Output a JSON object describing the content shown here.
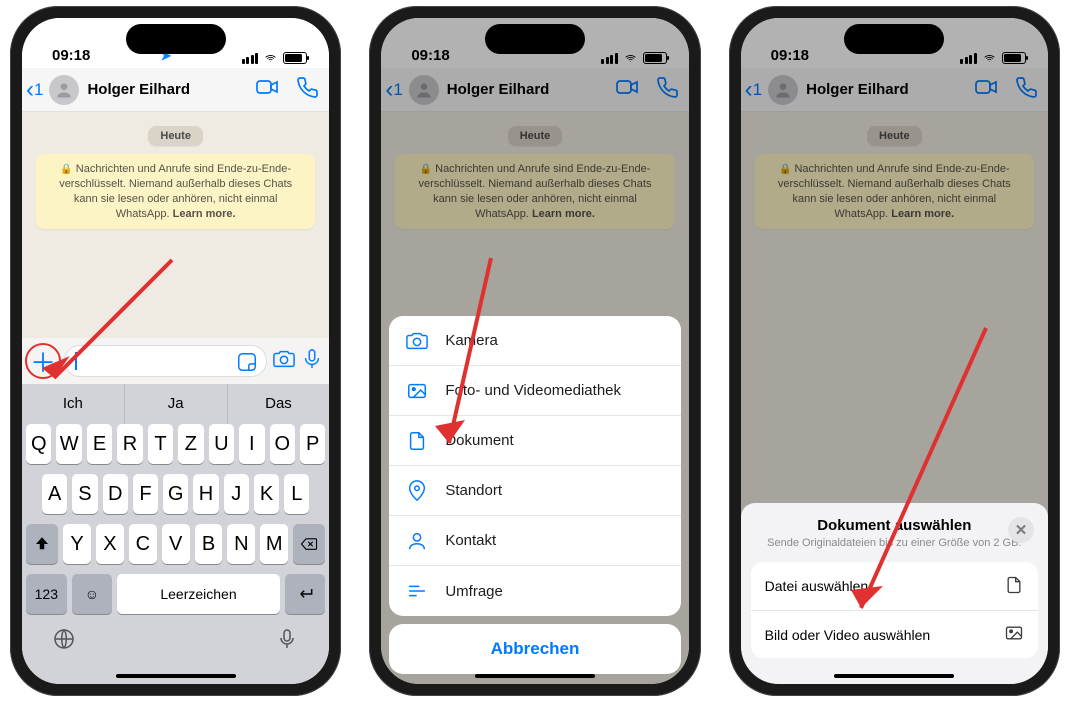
{
  "status": {
    "time": "09:18"
  },
  "chat": {
    "back_count": "1",
    "contact_name": "Holger Eilhard",
    "date_label": "Heute",
    "e2e_prefix": "Nachrichten und Anrufe sind Ende-zu-Ende-verschlüsselt. Niemand außerhalb dieses Chats kann sie lesen oder anhören, nicht einmal WhatsApp.",
    "e2e_learn": "Learn more."
  },
  "keyboard": {
    "suggestions": [
      "Ich",
      "Ja",
      "Das"
    ],
    "row1": [
      "Q",
      "W",
      "E",
      "R",
      "T",
      "Z",
      "U",
      "I",
      "O",
      "P"
    ],
    "row2": [
      "A",
      "S",
      "D",
      "F",
      "G",
      "H",
      "J",
      "K",
      "L"
    ],
    "row3": [
      "Y",
      "X",
      "C",
      "V",
      "B",
      "N",
      "M"
    ],
    "numkey": "123",
    "space": "Leerzeichen"
  },
  "attach_menu": {
    "items": [
      {
        "id": "camera",
        "label": "Kamera"
      },
      {
        "id": "photos",
        "label": "Foto- und Videomediathek"
      },
      {
        "id": "document",
        "label": "Dokument"
      },
      {
        "id": "location",
        "label": "Standort"
      },
      {
        "id": "contact",
        "label": "Kontakt"
      },
      {
        "id": "poll",
        "label": "Umfrage"
      }
    ],
    "cancel": "Abbrechen"
  },
  "doc_sheet": {
    "title": "Dokument auswählen",
    "subtitle": "Sende Originaldateien bis zu einer Größe von 2 GB.",
    "choose_file": "Datei auswählen",
    "choose_media": "Bild oder Video auswählen"
  }
}
